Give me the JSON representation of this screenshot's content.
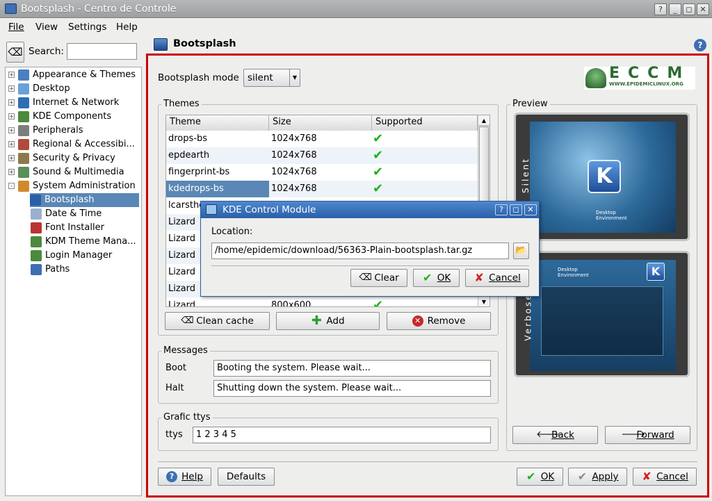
{
  "window": {
    "title": "Bootsplash - Centro de Controle"
  },
  "menus": [
    "File",
    "View",
    "Settings",
    "Help"
  ],
  "search": {
    "label": "Search:",
    "value": ""
  },
  "tree": [
    {
      "label": "Appearance & Themes",
      "sign": "+"
    },
    {
      "label": "Desktop",
      "sign": "+"
    },
    {
      "label": "Internet & Network",
      "sign": "+"
    },
    {
      "label": "KDE Components",
      "sign": "+"
    },
    {
      "label": "Peripherals",
      "sign": "+"
    },
    {
      "label": "Regional & Accessibi...",
      "sign": "+"
    },
    {
      "label": "Security & Privacy",
      "sign": "+"
    },
    {
      "label": "Sound & Multimedia",
      "sign": "+"
    },
    {
      "label": "System Administration",
      "sign": "-"
    }
  ],
  "subtree": [
    "Bootsplash",
    "Date & Time",
    "Font Installer",
    "KDM Theme Mana...",
    "Login Manager",
    "Paths"
  ],
  "module": {
    "title": "Bootsplash",
    "mode_label": "Bootsplash mode",
    "mode_value": "silent"
  },
  "logo": {
    "text": "ECCM",
    "url": "WWW.EPIDEMICLINUX.ORG"
  },
  "themes": {
    "label": "Themes",
    "columns": [
      "Theme",
      "Size",
      "Supported"
    ],
    "rows": [
      {
        "theme": "drops-bs",
        "size": "1024x768"
      },
      {
        "theme": "epdearth",
        "size": "1024x768"
      },
      {
        "theme": "fingerprint-bs",
        "size": "1024x768"
      },
      {
        "theme": "kdedrops-bs",
        "size": "1024x768"
      },
      {
        "theme": "lcarsthe",
        "size": ""
      },
      {
        "theme": "Lizard",
        "size": ""
      },
      {
        "theme": "Lizard",
        "size": ""
      },
      {
        "theme": "Lizard",
        "size": ""
      },
      {
        "theme": "Lizard",
        "size": ""
      },
      {
        "theme": "Lizard",
        "size": ""
      },
      {
        "theme": "Lizard",
        "size": "800x600"
      }
    ],
    "buttons": {
      "clean": "Clean cache",
      "add": "Add",
      "remove": "Remove"
    }
  },
  "preview": {
    "label": "Preview",
    "silent": "Silent",
    "verbose": "Verbose",
    "desktop_env": "Desktop Environment",
    "back": "Back",
    "forward": "Forward"
  },
  "messages": {
    "label": "Messages",
    "boot_label": "Boot",
    "boot_value": "Booting the system. Please wait...",
    "halt_label": "Halt",
    "halt_value": "Shutting down the system. Please wait..."
  },
  "ttys": {
    "label": "Grafic ttys",
    "field_label": "ttys",
    "value": "1 2 3 4 5"
  },
  "footer": {
    "help": "Help",
    "defaults": "Defaults",
    "ok": "OK",
    "apply": "Apply",
    "cancel": "Cancel"
  },
  "dialog": {
    "title": "KDE Control Module",
    "location_label": "Location:",
    "location_value": "/home/epidemic/download/56363-Plain-bootsplash.tar.gz",
    "clear": "Clear",
    "ok": "OK",
    "cancel": "Cancel"
  }
}
